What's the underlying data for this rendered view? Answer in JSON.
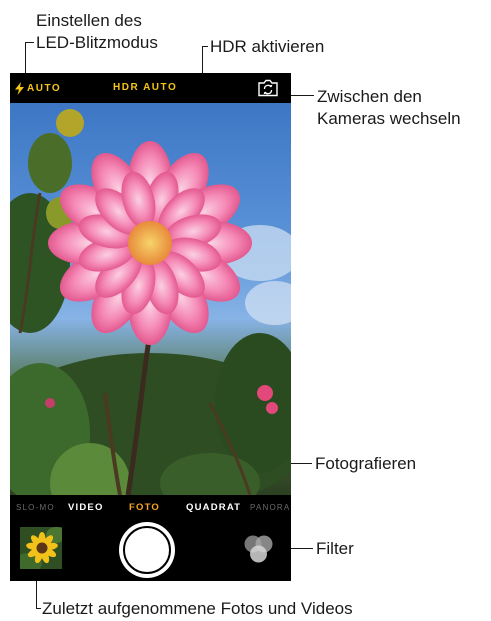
{
  "callouts": {
    "flash_line1": "Einstellen des",
    "flash_line2": "LED-Blitzmodus",
    "hdr": "HDR aktivieren",
    "switch_line1": "Zwischen den",
    "switch_line2": "Kameras wechseln",
    "shutter": "Fotografieren",
    "filter": "Filter",
    "recent": "Zuletzt aufgenommene Fotos und Videos"
  },
  "camera": {
    "flash_label": "AUTO",
    "flash_icon": "lightning-bolt-icon",
    "hdr_label": "HDR AUTO",
    "switch_icon": "camera-switch-icon",
    "modes": [
      "SLO-MO",
      "VIDEO",
      "FOTO",
      "QUADRAT",
      "PANORAMA"
    ],
    "selected_mode": "FOTO",
    "shutter_icon": "shutter-button",
    "filter_icon": "filter-circles-icon",
    "thumbnail": "recent-photo-thumbnail"
  },
  "colors": {
    "accent_yellow": "#f5c518",
    "active_mode": "#f5a623",
    "bar_background": "#000000",
    "flower_pink": "#f27fae"
  }
}
